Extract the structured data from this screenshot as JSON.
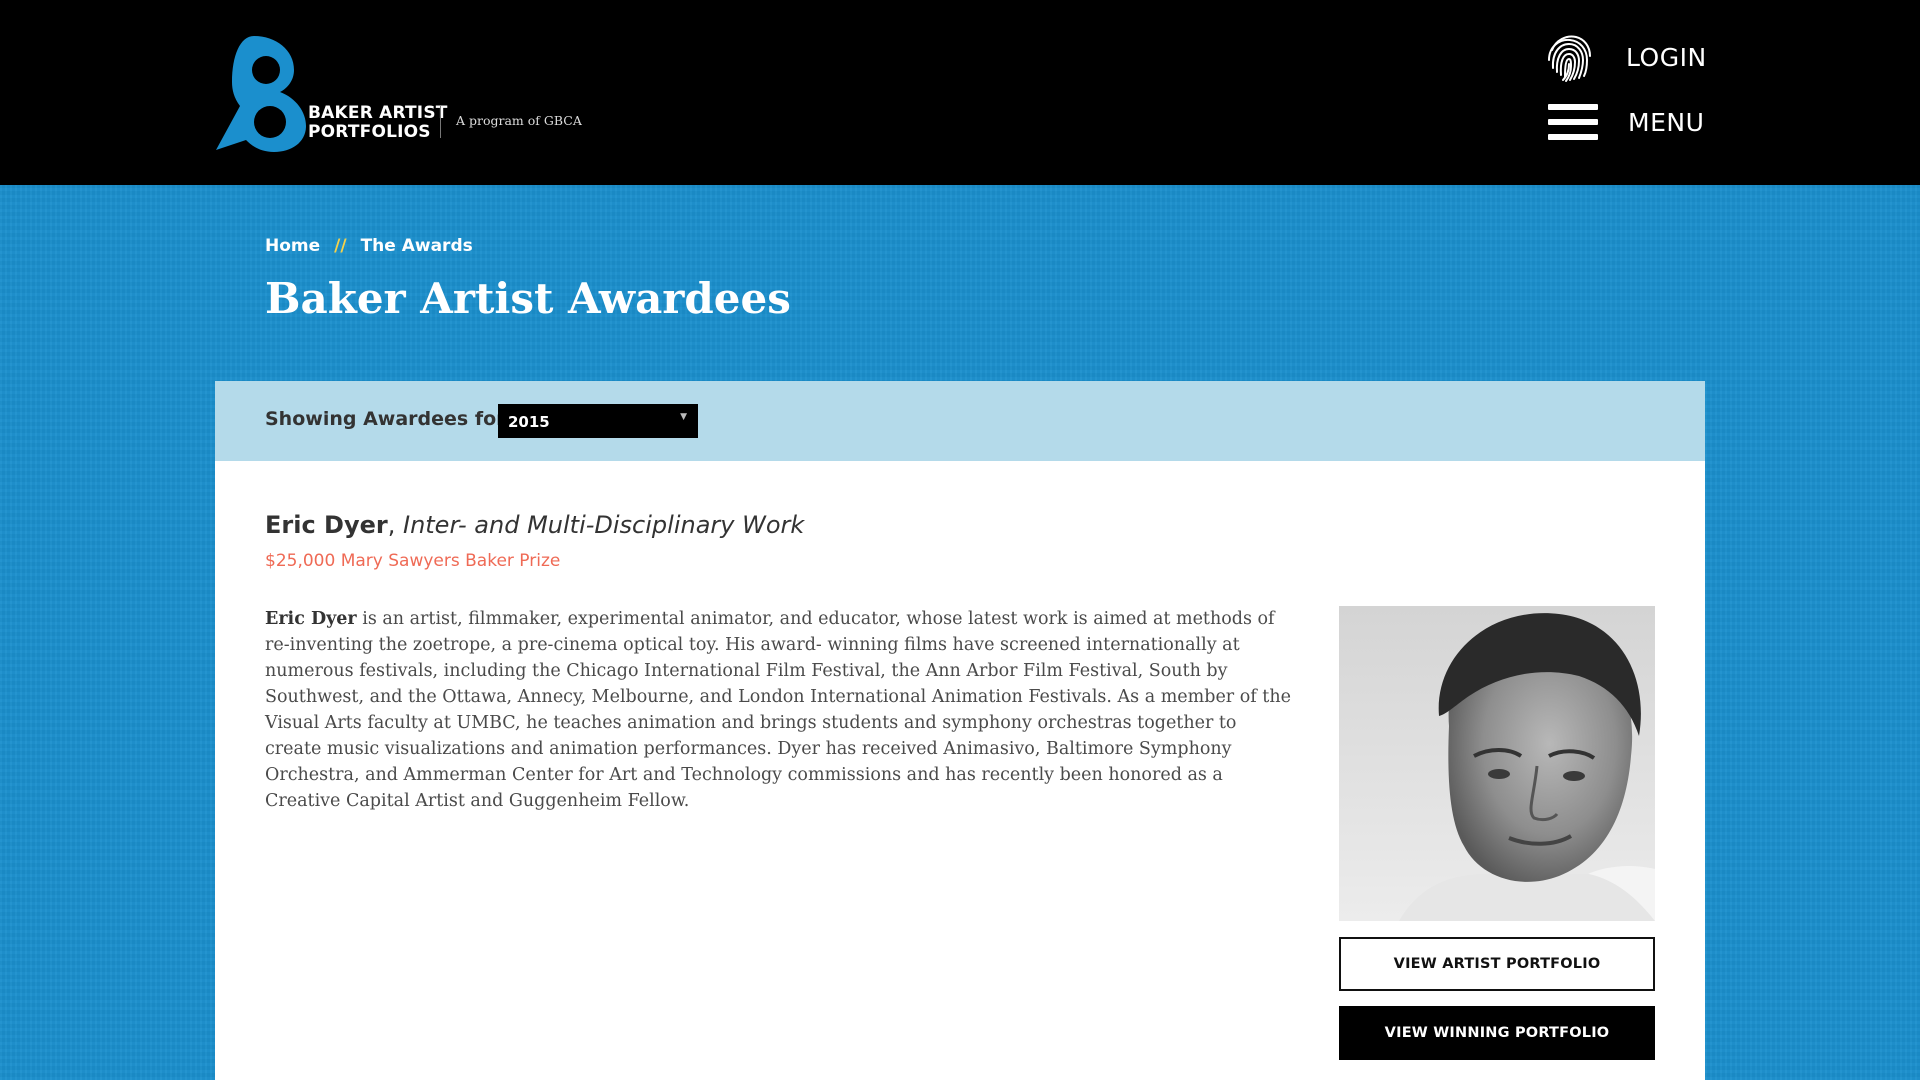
{
  "header": {
    "logo_text_line1": "BAKER ARTIST",
    "logo_text_line2": "PORTFOLIOS",
    "program_text": "A program of GBCA",
    "login_label": "LOGIN",
    "menu_label": "MENU",
    "login_icon": "fingerprint-icon",
    "menu_icon": "hamburger-icon"
  },
  "breadcrumb": {
    "items": [
      "Home",
      "The Awards"
    ],
    "separator": "//"
  },
  "page": {
    "title": "Baker Artist Awardees"
  },
  "filter": {
    "label": "Showing Awardees for",
    "selected_year": "2015"
  },
  "awardee": {
    "name": "Eric Dyer",
    "discipline": "Inter- and Multi-Disciplinary Work",
    "prize": "$25,000 Mary Sawyers Baker Prize",
    "bio_name": "Eric Dyer",
    "bio_text": " is an artist, filmmaker, experimental animator, and educator, whose latest work is aimed at methods of re-inventing the zoetrope, a pre-cinema optical toy. His award- winning films have screened internationally at numerous festivals, including the Chicago International Film Festival, the Ann Arbor Film Festival, South by Southwest, and the Ottawa, Annecy, Melbourne, and London International Animation Festivals. As a member of the Visual Arts faculty at UMBC, he teaches animation and brings students and symphony orchestras together to create music visualizations and animation performances. Dyer has received Animasivo, Baltimore Symphony Orchestra, and Ammerman Center for Art and Technology commissions and has recently been honored as a Creative Capital Artist and Guggenheim Fellow.",
    "view_artist_label": "VIEW ARTIST PORTFOLIO",
    "view_winning_label": "VIEW WINNING PORTFOLIO"
  },
  "colors": {
    "header_bg": "#000000",
    "page_blue": "#1b8fcd",
    "filter_bar": "#b4daea",
    "prize_text": "#ef6a55",
    "breadcrumb_sep": "#f5d24a"
  }
}
